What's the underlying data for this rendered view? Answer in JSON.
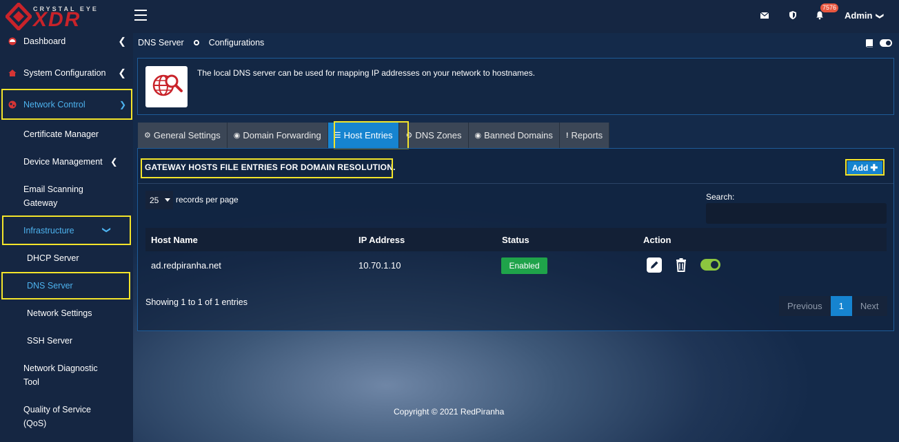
{
  "brand": {
    "top": "CRYSTAL EYE",
    "main": "XDR"
  },
  "topbar": {
    "notification_count": "7576",
    "admin_label": "Admin"
  },
  "sidebar": {
    "items": [
      {
        "label": "Dashboard"
      },
      {
        "label": "System Configuration"
      },
      {
        "label": "Network Control"
      }
    ],
    "network_control_children": [
      {
        "label": "Certificate Manager"
      },
      {
        "label": "Device Management"
      },
      {
        "label": "Email Scanning"
      },
      {
        "label": "Gateway"
      },
      {
        "label": "Infrastructure"
      }
    ],
    "infrastructure_children": [
      {
        "label": "DHCP Server"
      },
      {
        "label": "DNS Server"
      },
      {
        "label": "Network Settings"
      },
      {
        "label": "SSH Server"
      }
    ],
    "more": [
      {
        "label": "Network Diagnostic"
      },
      {
        "label": "Tool"
      },
      {
        "label": "Quality of Service"
      },
      {
        "label": "(QoS)"
      }
    ]
  },
  "breadcrumb": {
    "section": "DNS Server",
    "page": "Configurations"
  },
  "info": {
    "text": "The local DNS server can be used for mapping IP addresses on your network to hostnames."
  },
  "tabs": [
    {
      "label": "General Settings",
      "icon": "gears-icon"
    },
    {
      "label": "Domain Forwarding",
      "icon": "globe-icon"
    },
    {
      "label": "Host Entries",
      "icon": "list-icon"
    },
    {
      "label": "DNS Zones",
      "icon": "gear-icon"
    },
    {
      "label": "Banned Domains",
      "icon": "globe-icon"
    },
    {
      "label": "Reports",
      "icon": "exclamation-icon"
    }
  ],
  "panel": {
    "title": "GATEWAY HOSTS FILE ENTRIES FOR DOMAIN RESOLUTION.",
    "add_label": "Add"
  },
  "table_controls": {
    "page_length": "25",
    "page_length_label": "records per page",
    "search_label": "Search:",
    "search_value": ""
  },
  "table": {
    "columns": [
      "Host Name",
      "IP Address",
      "Status",
      "Action"
    ],
    "rows": [
      {
        "host": "ad.redpiranha.net",
        "ip": "10.70.1.10",
        "status": "Enabled"
      }
    ]
  },
  "pagination": {
    "info": "Showing 1 to 1 of 1 entries",
    "previous": "Previous",
    "current": "1",
    "next": "Next"
  },
  "footer": {
    "text": "Copyright © 2021 RedPiranha"
  },
  "colors": {
    "accent": "#1684d0",
    "highlight": "#f4e52a",
    "enabled": "#1fa34a",
    "brand_red": "#c9232a"
  }
}
